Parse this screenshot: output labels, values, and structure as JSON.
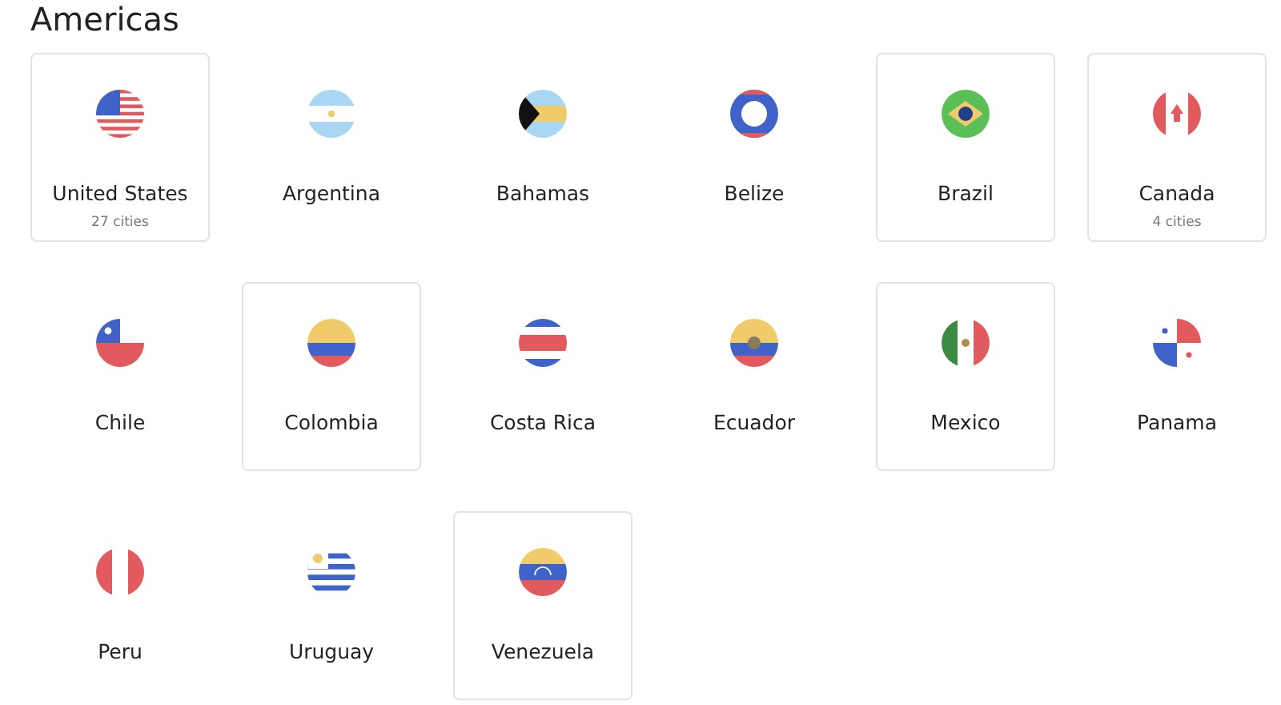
{
  "heading": "Americas",
  "countries": [
    {
      "name": "United States",
      "cities": "27 cities",
      "highlighted": true
    },
    {
      "name": "Argentina",
      "highlighted": false
    },
    {
      "name": "Bahamas",
      "highlighted": false
    },
    {
      "name": "Belize",
      "highlighted": false
    },
    {
      "name": "Brazil",
      "highlighted": true
    },
    {
      "name": "Canada",
      "cities": "4 cities",
      "highlighted": true
    },
    {
      "name": "Chile",
      "highlighted": false
    },
    {
      "name": "Colombia",
      "highlighted": true
    },
    {
      "name": "Costa Rica",
      "highlighted": false
    },
    {
      "name": "Ecuador",
      "highlighted": false
    },
    {
      "name": "Mexico",
      "highlighted": true
    },
    {
      "name": "Panama",
      "highlighted": false
    },
    {
      "name": "Peru",
      "highlighted": false
    },
    {
      "name": "Uruguay",
      "highlighted": false
    },
    {
      "name": "Venezuela",
      "highlighted": true
    }
  ]
}
